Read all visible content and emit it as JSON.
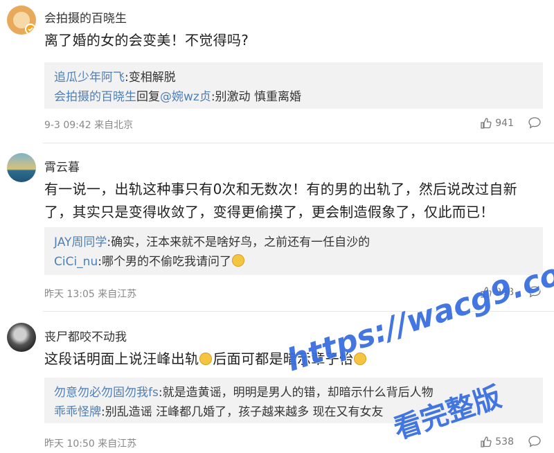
{
  "comments": [
    {
      "username": "会拍摄的百晓生",
      "text": "离了婚的女的会变美！不觉得吗?",
      "replies": [
        {
          "name": "追瓜少年阿飞",
          "content": ":变相解脱"
        },
        {
          "name": "会拍摄的百晓生",
          "mid": "回复",
          "to": "@婉wz贞",
          "content": ":别激动 慎重离婚"
        }
      ],
      "meta": "9-3 09:42 来自北京",
      "likes": "941"
    },
    {
      "username": "霄云暮",
      "text": "有一说一，出轨这种事只有0次和无数次！有的男的出轨了，然后说改过自新了，其实只是变得收敛了，变得更偷摸了，更会制造假象了，仅此而已！",
      "replies": [
        {
          "name": "JAY周同学",
          "content": ":确实，汪本来就不是啥好鸟，之前还有一任自沙的"
        },
        {
          "name": "CiCi_nu",
          "content": ":哪个男的不偷吃我请问了"
        }
      ],
      "meta": "昨天 13:05 来自江苏",
      "likes": "968"
    },
    {
      "username": "丧尸都咬不动我",
      "text_a": "这段话明面上说汪峰出轨",
      "text_b": "后面可都是暗示章子怡",
      "replies": [
        {
          "name": "勿意勿必勿固勿我fs",
          "content": ":就是造黄谣，明明是男人的错，却暗示什么背后人物"
        },
        {
          "name": "乖乖怪牌",
          "content": ":别乱造谣 汪峰都几婚了，孩子越来越多 现在又有女友"
        }
      ],
      "meta": "昨天 10:50 来自江苏",
      "likes": "538"
    }
  ],
  "watermark": {
    "url": "https://wacg9.com",
    "tag": "看完整版"
  },
  "icons": {
    "like": "thumbs-up-icon",
    "comment": "speech-bubble-icon",
    "emoji": "laughing-emoji-icon"
  },
  "colors": {
    "reply_name": "#4e7fb5",
    "reply_bg": "#f2f2f2",
    "watermark": "#3a6fe0"
  }
}
